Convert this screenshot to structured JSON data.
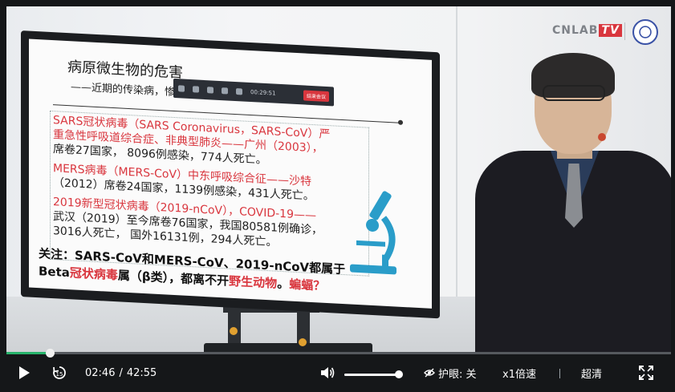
{
  "player": {
    "current_time": "02:46",
    "duration": "42:55",
    "time_separator": "/",
    "progress": 0.0647,
    "volume": 0.95,
    "eye_protect_label": "护眼: 关",
    "speed_label": "x1倍速",
    "quality_label": "超清",
    "fill_color": "#27b36b"
  },
  "watermark": {
    "brand": "CNLAB",
    "brand_tv": "TV"
  },
  "slide": {
    "title": "病原微生物的危害",
    "subtitle": "——近期的传染病，惨痛的教训，逼迫我们思考",
    "meeting_time": "00:29:51",
    "meeting_end": "结束会议",
    "lines": [
      {
        "text": "SARS冠状病毒（SARS Coronavirus，SARS-CoV）严",
        "color": "red"
      },
      {
        "text": "重急性呼吸道综合症、非典型肺炎——广州（2003），",
        "color": "red"
      },
      {
        "text": "席卷27国家， 8096例感染，774人死亡。",
        "color": "dark"
      },
      {
        "text": "MERS病毒（MERS-CoV）中东呼吸综合征——沙特",
        "color": "red"
      },
      {
        "text": "（2012）席卷24国家，1139例感染，431人死亡。",
        "color": "dark"
      },
      {
        "text": "2019新型冠状病毒（2019-nCoV），COVID-19——",
        "color": "red"
      },
      {
        "text": "武汉（2019）至今席卷76国家，我国80581例确诊，",
        "color": "dark"
      },
      {
        "text": "3016人死亡， 国外16131例，294人死亡。",
        "color": "dark"
      }
    ],
    "note_line1_a": "关注：SARS-CoV和MERS-CoV、2019-nCoV都属于",
    "note_line2_a": "Beta",
    "note_line2_b": "冠状病毒",
    "note_line2_c": "属（β类），都离不开",
    "note_line2_d": "野生动物",
    "note_line2_e": "。",
    "note_line2_f": "蝙蝠？"
  },
  "icons": {
    "play": "play-icon",
    "replay": "replay-15-icon",
    "volume": "volume-icon",
    "eye": "eye-off-icon",
    "fullscreen": "fullscreen-icon"
  }
}
